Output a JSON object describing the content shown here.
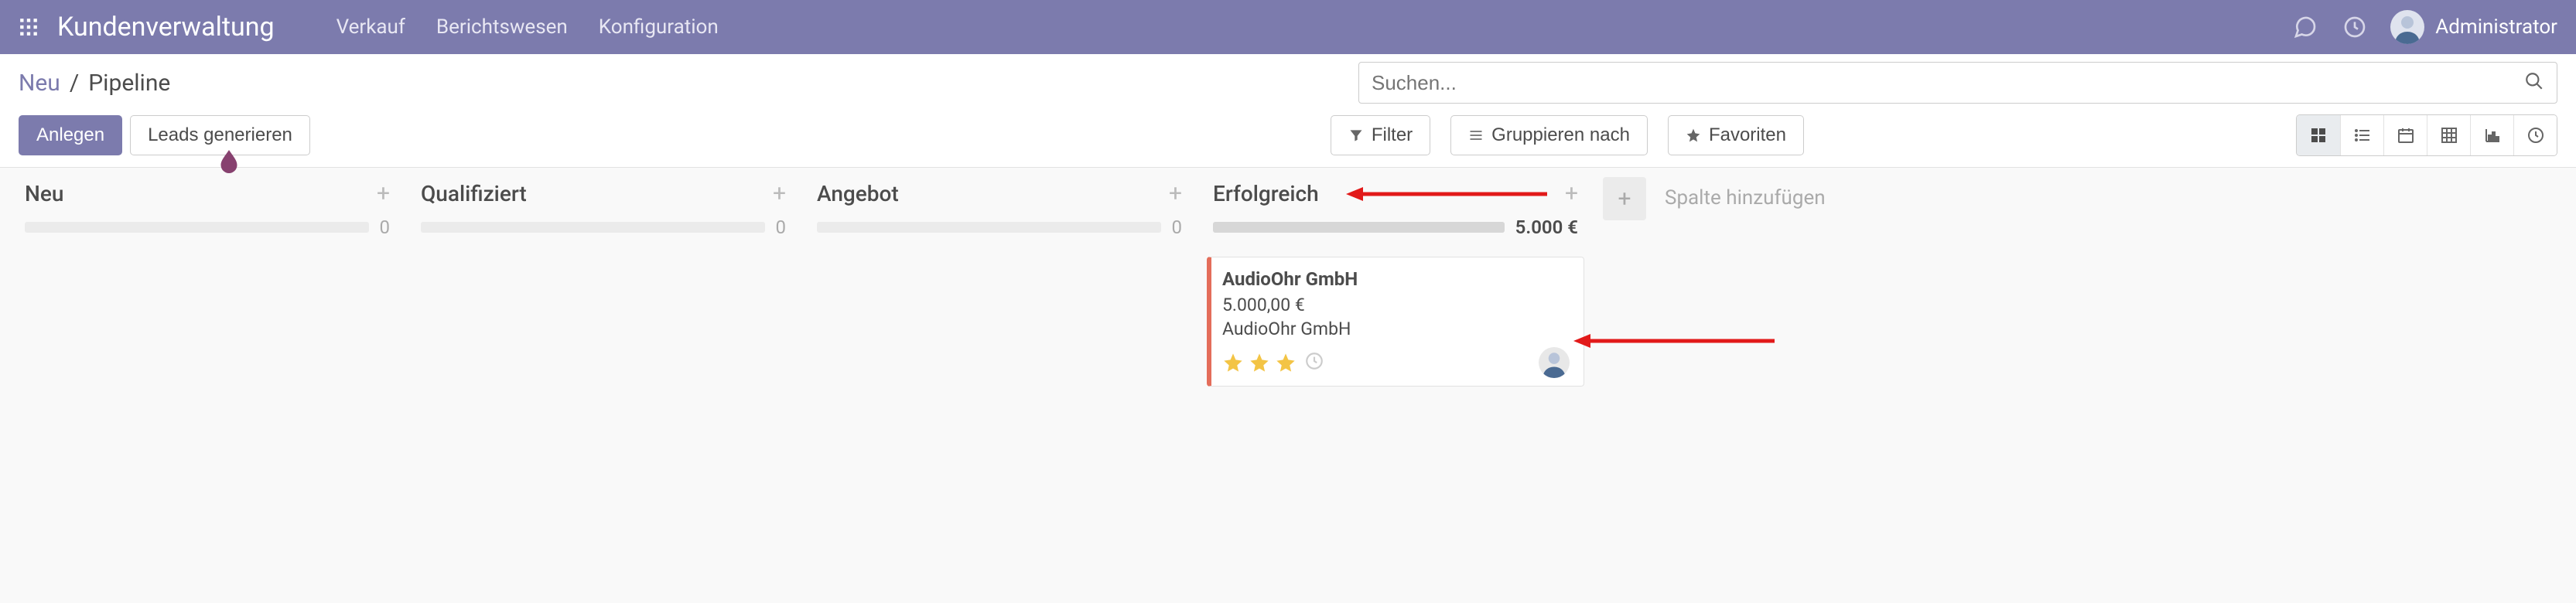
{
  "navbar": {
    "app_title": "Kundenverwaltung",
    "menu": [
      "Verkauf",
      "Berichtswesen",
      "Konfiguration"
    ],
    "user_name": "Administrator"
  },
  "breadcrumb": {
    "parent": "Neu",
    "current": "Pipeline"
  },
  "buttons": {
    "create": "Anlegen",
    "generate_leads": "Leads generieren",
    "filter": "Filter",
    "group_by": "Gruppieren nach",
    "favorites": "Favoriten"
  },
  "search": {
    "placeholder": "Suchen..."
  },
  "columns": [
    {
      "title": "Neu",
      "count": "0",
      "amount": "",
      "bar_fill_pct": 0
    },
    {
      "title": "Qualifiziert",
      "count": "0",
      "amount": "",
      "bar_fill_pct": 0
    },
    {
      "title": "Angebot",
      "count": "0",
      "amount": "",
      "bar_fill_pct": 0
    },
    {
      "title": "Erfolgreich",
      "count": "",
      "amount": "5.000 €",
      "bar_fill_pct": 100
    }
  ],
  "add_column_label": "Spalte hinzufügen",
  "card": {
    "title": "AudioOhr GmbH",
    "amount": "5.000,00 €",
    "customer": "AudioOhr GmbH",
    "stars_filled": 3,
    "stars_total": 3
  },
  "colors": {
    "brand": "#7c7bad",
    "card_accent": "#e46d5a",
    "star_fill": "#f3c445",
    "arrow": "#e21a1a"
  }
}
